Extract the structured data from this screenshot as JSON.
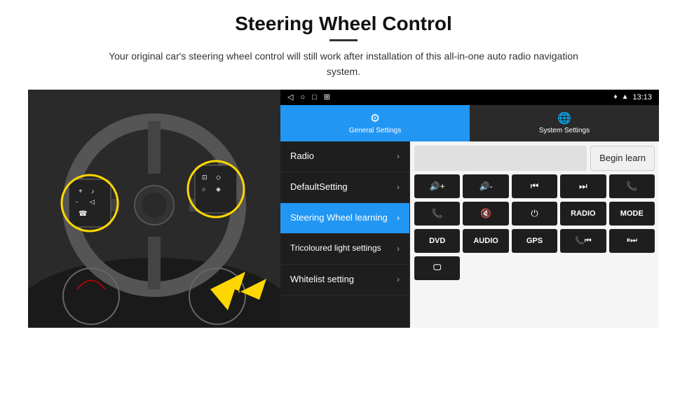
{
  "header": {
    "title": "Steering Wheel Control",
    "subtitle": "Your original car's steering wheel control will still work after installation of this all-in-one auto radio navigation system."
  },
  "status_bar": {
    "time": "13:13",
    "icons": [
      "◁",
      "○",
      "□",
      "⊞"
    ]
  },
  "tabs": [
    {
      "label": "General Settings",
      "active": true,
      "icon": "⚙"
    },
    {
      "label": "System Settings",
      "active": false,
      "icon": "🌐"
    }
  ],
  "menu_items": [
    {
      "label": "Radio",
      "active": false
    },
    {
      "label": "DefaultSetting",
      "active": false
    },
    {
      "label": "Steering Wheel learning",
      "active": true
    },
    {
      "label": "Tricoloured light settings",
      "active": false
    },
    {
      "label": "Whitelist setting",
      "active": false
    }
  ],
  "begin_learn_label": "Begin learn",
  "control_buttons_row1": [
    {
      "icon": "🔊+",
      "label": "vol-up"
    },
    {
      "icon": "🔊-",
      "label": "vol-down"
    },
    {
      "icon": "⏮",
      "label": "prev"
    },
    {
      "icon": "⏭",
      "label": "next"
    },
    {
      "icon": "📞",
      "label": "call"
    }
  ],
  "control_buttons_row2": [
    {
      "icon": "📞",
      "label": "answer"
    },
    {
      "icon": "🔇",
      "label": "mute"
    },
    {
      "icon": "⏻",
      "label": "power"
    },
    {
      "icon": "RADIO",
      "label": "radio"
    },
    {
      "icon": "MODE",
      "label": "mode"
    }
  ],
  "control_buttons_row3": [
    {
      "icon": "DVD",
      "label": "dvd"
    },
    {
      "icon": "AUDIO",
      "label": "audio"
    },
    {
      "icon": "GPS",
      "label": "gps"
    },
    {
      "icon": "📞⏮",
      "label": "tel-prev"
    },
    {
      "icon": "⏸⏭",
      "label": "pause-next"
    }
  ],
  "bottom_row": [
    {
      "icon": "🖵",
      "label": "screen"
    }
  ]
}
